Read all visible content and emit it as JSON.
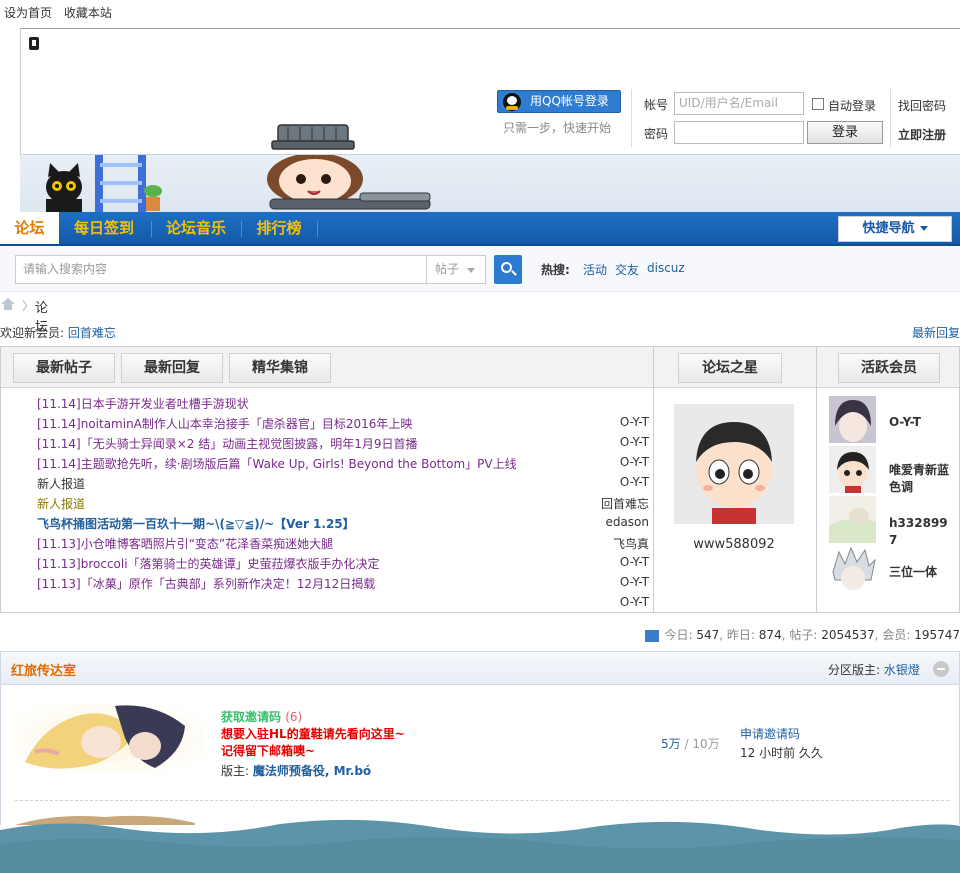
{
  "top_links": [
    "设为首页",
    "收藏本站"
  ],
  "login": {
    "qq_button": "用QQ帐号登录",
    "qq_tip": "只需一步，快速开始",
    "account_label": "帐号",
    "account_placeholder": "UID/用户名/Email",
    "password_label": "密码",
    "auto_login": "自动登录",
    "login_button": "登录",
    "forgot_password": "找回密码",
    "register": "立即注册"
  },
  "nav": {
    "items": [
      "论坛",
      "每日签到",
      "论坛音乐",
      "排行榜"
    ],
    "quick_nav": "快捷导航"
  },
  "search": {
    "placeholder": "请输入搜索内容",
    "type": "帖子",
    "hot_label": "热搜:",
    "hot_terms": [
      "活动",
      "交友",
      "discuz"
    ]
  },
  "breadcrumb": {
    "current": "论坛"
  },
  "welcome": {
    "text": "欢迎新会员: ",
    "member": "回首难忘",
    "latest_replies": "最新回复"
  },
  "portal": {
    "tabs": [
      "最新帖子",
      "最新回复",
      "精华集锦"
    ],
    "star_tab": "论坛之星",
    "active_tab": "活跃会员",
    "posts": [
      {
        "title": "[11.14]日本手游开发业者吐槽手游现状",
        "author": ""
      },
      {
        "title": "[11.14]noitaminA制作人山本幸治接手「虐杀器官」目标2016年上映",
        "author": "O-Y-T"
      },
      {
        "title": "[11.14]「无头骑士异闻录×2 结」动画主视觉图披露，明年1月9日首播",
        "author": "O-Y-T"
      },
      {
        "title": "[11.14]主题歌抢先听，续·剧场版后篇「Wake Up, Girls! Beyond the Bottom」PV上线",
        "author": "O-Y-T"
      },
      {
        "title": "新人报道",
        "author": "O-Y-T"
      },
      {
        "title": "新人报道",
        "author": "回首难忘"
      },
      {
        "title": "飞鸟杯捅图活动第一百玖十一期~\\(≧▽≦)/~【Ver 1.25】",
        "author": "edason"
      },
      {
        "title": "[11.13]小仓唯博客晒照片引“变态”花泽香菜痴迷她大腿",
        "author": "飞鸟真"
      },
      {
        "title": "[11.13]broccoli「落第骑士的英雄谭」史萤菈爆衣版手办化决定",
        "author": "O-Y-T"
      },
      {
        "title": "[11.13]「冰菓」原作「古典部」系列新作决定！12月12日揭载",
        "author": "O-Y-T"
      },
      {
        "title": "",
        "author": "O-Y-T"
      }
    ],
    "star": {
      "name": "www588092"
    },
    "members": [
      {
        "name": "O-Y-T"
      },
      {
        "name": "唯爱青新蓝色调"
      },
      {
        "name": "h3328997"
      },
      {
        "name": "三位一体"
      }
    ]
  },
  "stats": {
    "today_label": "今日:",
    "today": "547",
    "yesterday_label": "昨日:",
    "yesterday": "874",
    "posts_label": "帖子:",
    "posts": "2054537",
    "members_label": "会员:",
    "members": "195747"
  },
  "category": {
    "title": "红旅传达室",
    "moderator_label": "分区版主:",
    "moderator": "水银燈"
  },
  "forum": {
    "name": "获取邀请码",
    "count": "(6)",
    "desc_line1": "想要入驻HL的童鞋请先看向这里~",
    "desc_line2": "记得留下邮箱噢~",
    "mod_label": "版主:",
    "mods": "魔法师预备役, Mr.bó",
    "threads": "5万",
    "slash": "/",
    "posts": "10万",
    "last_title": "申请邀请码",
    "last_time": "12 小时前",
    "last_user": "久久"
  },
  "colors": {
    "nav_bg": "#1d6fc4",
    "nav_text": "#f3c300",
    "link": "#1f5f9f",
    "post_link": "#7a2a8c",
    "category_title": "#e46b00",
    "wave": "#5c95a9"
  }
}
